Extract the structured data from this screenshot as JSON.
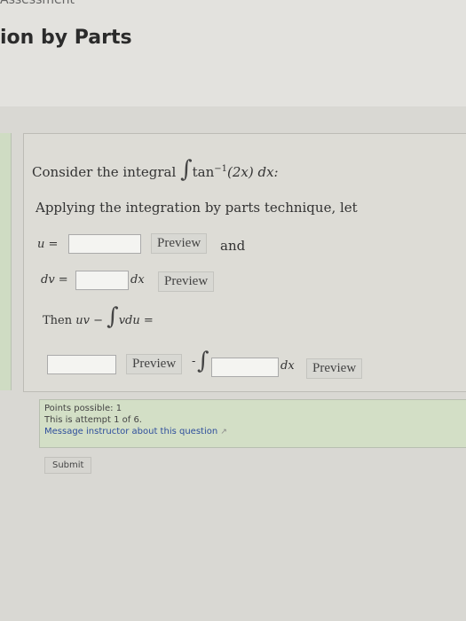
{
  "header": {
    "breadcrumb": "Assessment",
    "title": "ion by Parts"
  },
  "question": {
    "intro": "Consider the integral",
    "integrand": "tan",
    "exponent": "−1",
    "argument": "(2x) dx:",
    "instruction": "Applying the integration by parts technique, let",
    "u_label": "u =",
    "u_value": "",
    "and": "and",
    "dv_label": "dv =",
    "dv_value": "",
    "dx": "dx",
    "then": "Then",
    "uv": "uv −",
    "vdu": "vdu =",
    "uv_value": "",
    "minus": "-",
    "integral_value": "",
    "preview": "Preview",
    "integral_sign": "∫"
  },
  "info": {
    "points": "Points possible: 1",
    "attempt": "This is attempt 1 of 6.",
    "message_link": "Message instructor about this question",
    "external_icon": "↗"
  },
  "submit": "Submit"
}
